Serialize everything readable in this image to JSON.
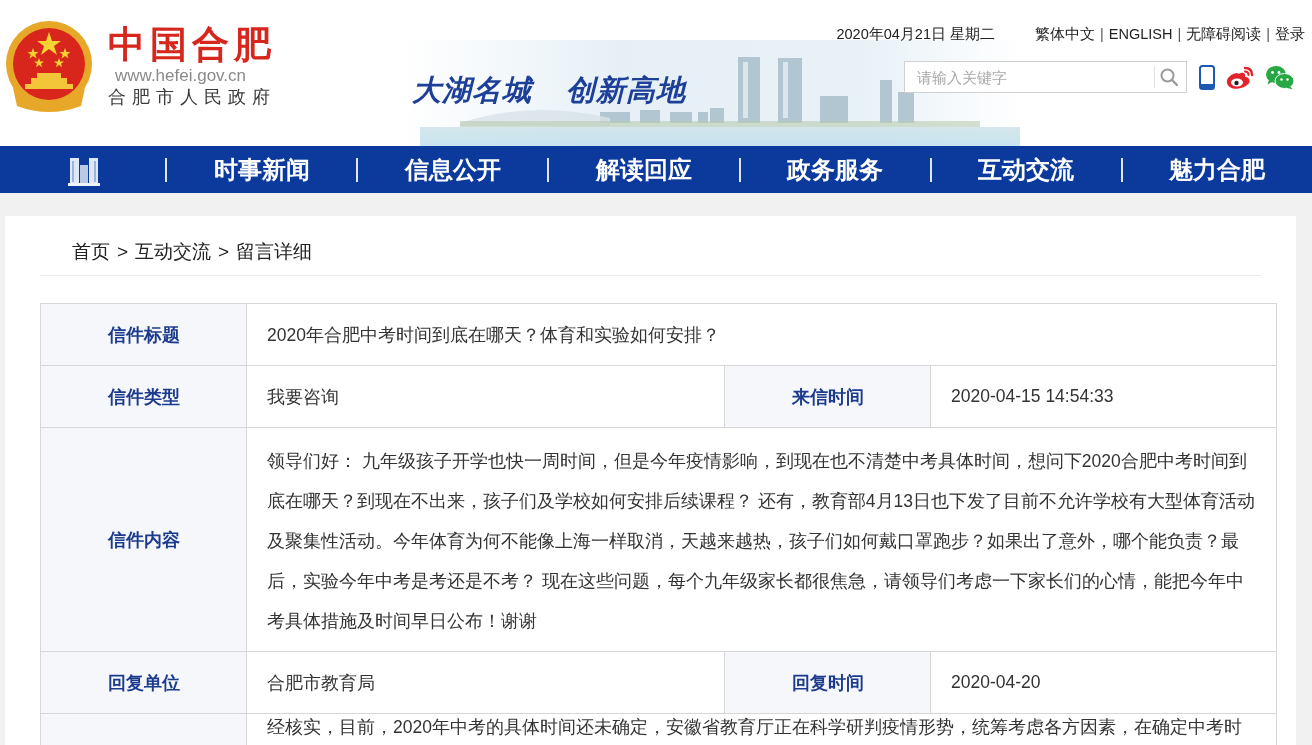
{
  "header": {
    "site_name": "中国合肥",
    "site_url": "www.hefei.gov.cn",
    "site_org": "合肥市人民政府",
    "slogan": [
      "大湖名城",
      "创新高地"
    ],
    "date": "2020年04月21日 星期二",
    "top_links": {
      "items": [
        "繁体中文",
        "ENGLISH",
        "无障碍阅读",
        "登录"
      ],
      "separator": "|"
    },
    "search": {
      "placeholder": "请输入关键字"
    }
  },
  "nav": {
    "items": [
      "时事新闻",
      "信息公开",
      "解读回应",
      "政务服务",
      "互动交流",
      "魅力合肥"
    ]
  },
  "breadcrumb": {
    "items": [
      "首页",
      "互动交流",
      "留言详细"
    ],
    "separator": ">"
  },
  "letter": {
    "rows": [
      {
        "kind": "line",
        "cells": [
          {
            "kind": "head",
            "text": "信件标题"
          },
          {
            "kind": "data",
            "text": "2020年合肥中考时间到底在哪天？体育和实验如何安排？",
            "colspan": 3
          }
        ]
      },
      {
        "kind": "line",
        "cells": [
          {
            "kind": "head",
            "text": "信件类型"
          },
          {
            "kind": "data",
            "text": "我要咨询"
          },
          {
            "kind": "head",
            "text": "来信时间"
          },
          {
            "kind": "data",
            "text": "2020-04-15 14:54:33"
          }
        ]
      },
      {
        "kind": "text",
        "cells": [
          {
            "kind": "head",
            "text": "信件内容"
          },
          {
            "kind": "data",
            "text": "领导们好： 九年级孩子开学也快一周时间，但是今年疫情影响，到现在也不清楚中考具体时间，想问下2020合肥中考时间到底在哪天？到现在不出来，孩子们及学校如何安排后续课程？ 还有，教育部4月13日也下发了目前不允许学校有大型体育活动及聚集性活动。今年体育为何不能像上海一样取消，天越来越热，孩子们如何戴口罩跑步？如果出了意外，哪个能负责？最后，实验今年中考是考还是不考？ 现在这些问题，每个九年级家长都很焦急，请领导们考虑一下家长们的心情，能把今年中考具体措施及时间早日公布！谢谢",
            "colspan": 3
          }
        ]
      },
      {
        "kind": "line",
        "cells": [
          {
            "kind": "head",
            "text": "回复单位"
          },
          {
            "kind": "data",
            "text": "合肥市教育局"
          },
          {
            "kind": "head",
            "text": "回复时间"
          },
          {
            "kind": "data",
            "text": "2020-04-20"
          }
        ]
      },
      {
        "kind": "text",
        "cells": [
          {
            "kind": "head"
          },
          {
            "kind": "data",
            "text": "经核实，目前，2020年中考的具体时间还未确定，安徽省教育厅正在科学研判疫情形势，统筹考虑各方因素，在确定中考时",
            "colspan": 3
          }
        ]
      }
    ]
  }
}
